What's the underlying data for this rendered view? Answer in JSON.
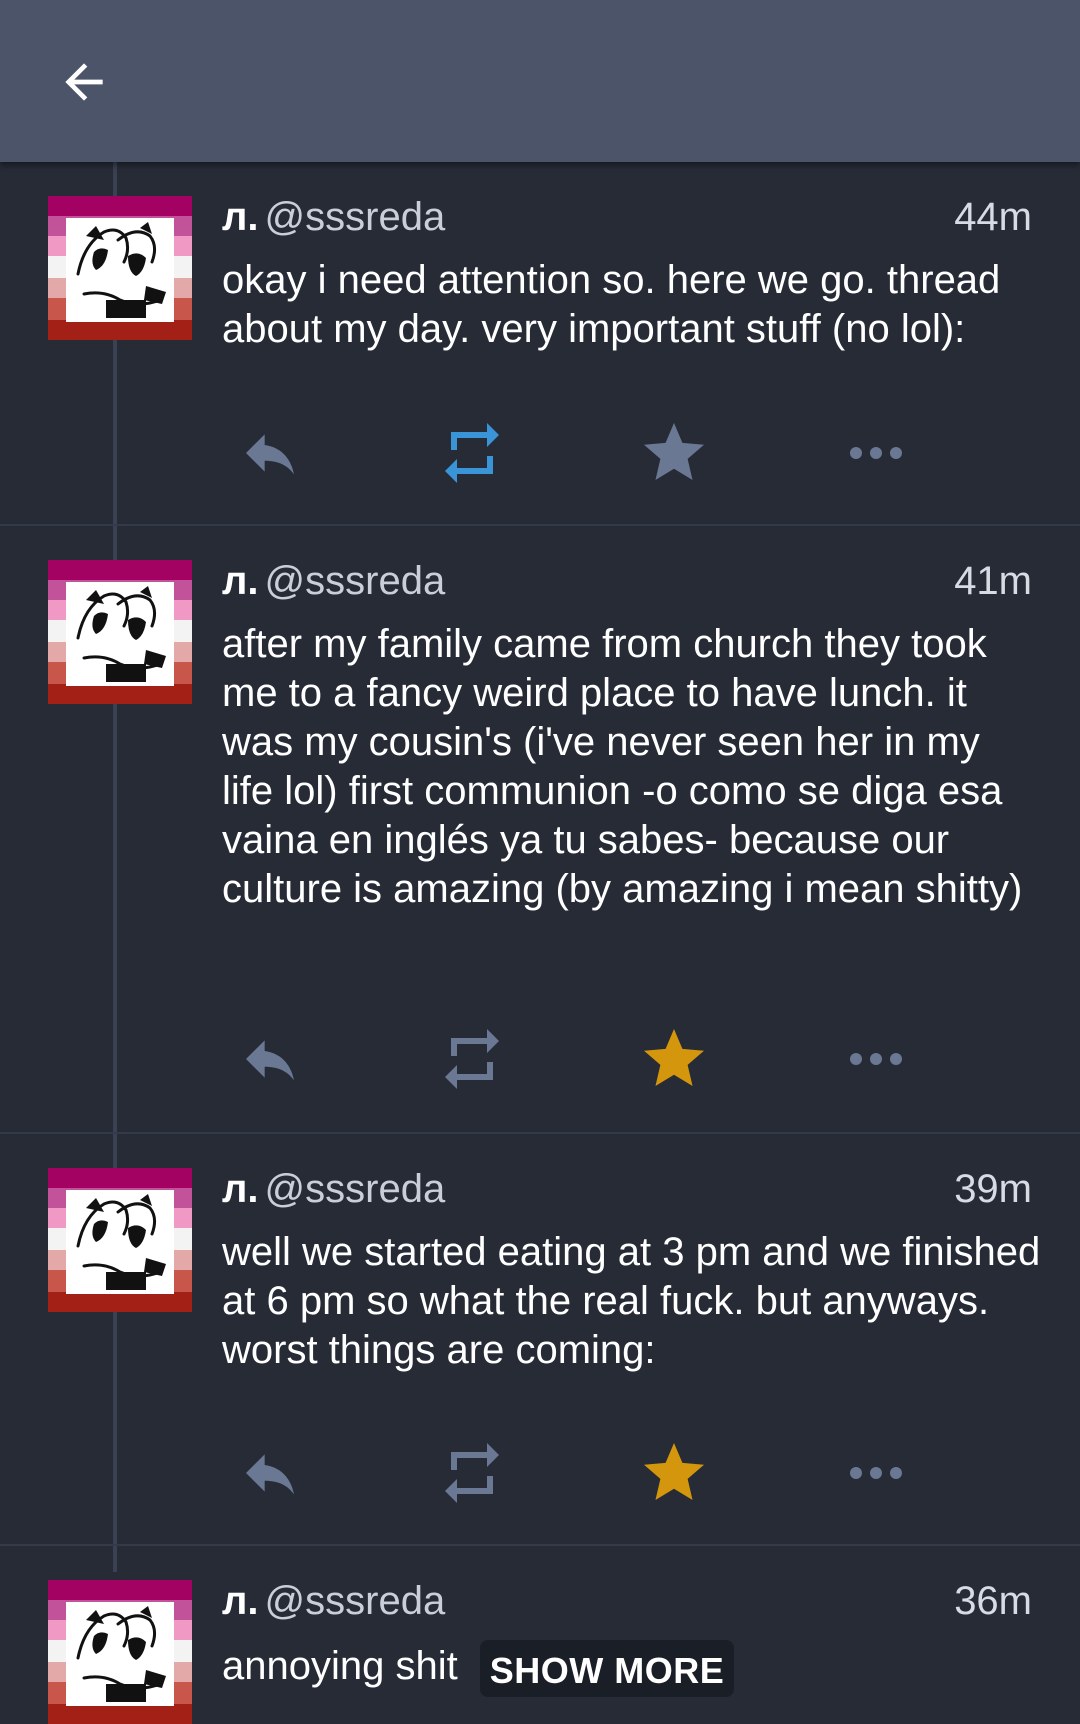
{
  "header": {
    "back_icon": "arrow-left-icon"
  },
  "colors": {
    "topbar": "#4c5469",
    "background": "#262b36",
    "icon_default": "#6a7894",
    "retweet_active": "#3a95d8",
    "favorite_active": "#d4960c"
  },
  "tweets": [
    {
      "name": "л.",
      "handle": "@sssreda",
      "time": "44m",
      "text": "okay i need attention so. here we go. thread about my day. very important stuff (no lol):",
      "retweeted": true,
      "favorited": false
    },
    {
      "name": "л.",
      "handle": "@sssreda",
      "time": "41m",
      "text": "after my family came from church they took me to a fancy weird place to have lunch. it was my cousin's (i've never seen her in my life lol) first communion -o como se diga esa vaina en inglés ya tu sabes- because our culture is amazing (by amazing i mean shitty)",
      "retweeted": false,
      "favorited": true
    },
    {
      "name": "л.",
      "handle": "@sssreda",
      "time": "39m",
      "text": "well we started eating at 3 pm and we finished at 6 pm so what the real fuck. but anyways. worst things are coming:",
      "retweeted": false,
      "favorited": true
    },
    {
      "name": "л.",
      "handle": "@sssreda",
      "time": "36m",
      "text": "annoying shit",
      "show_more": "SHOW MORE"
    }
  ]
}
